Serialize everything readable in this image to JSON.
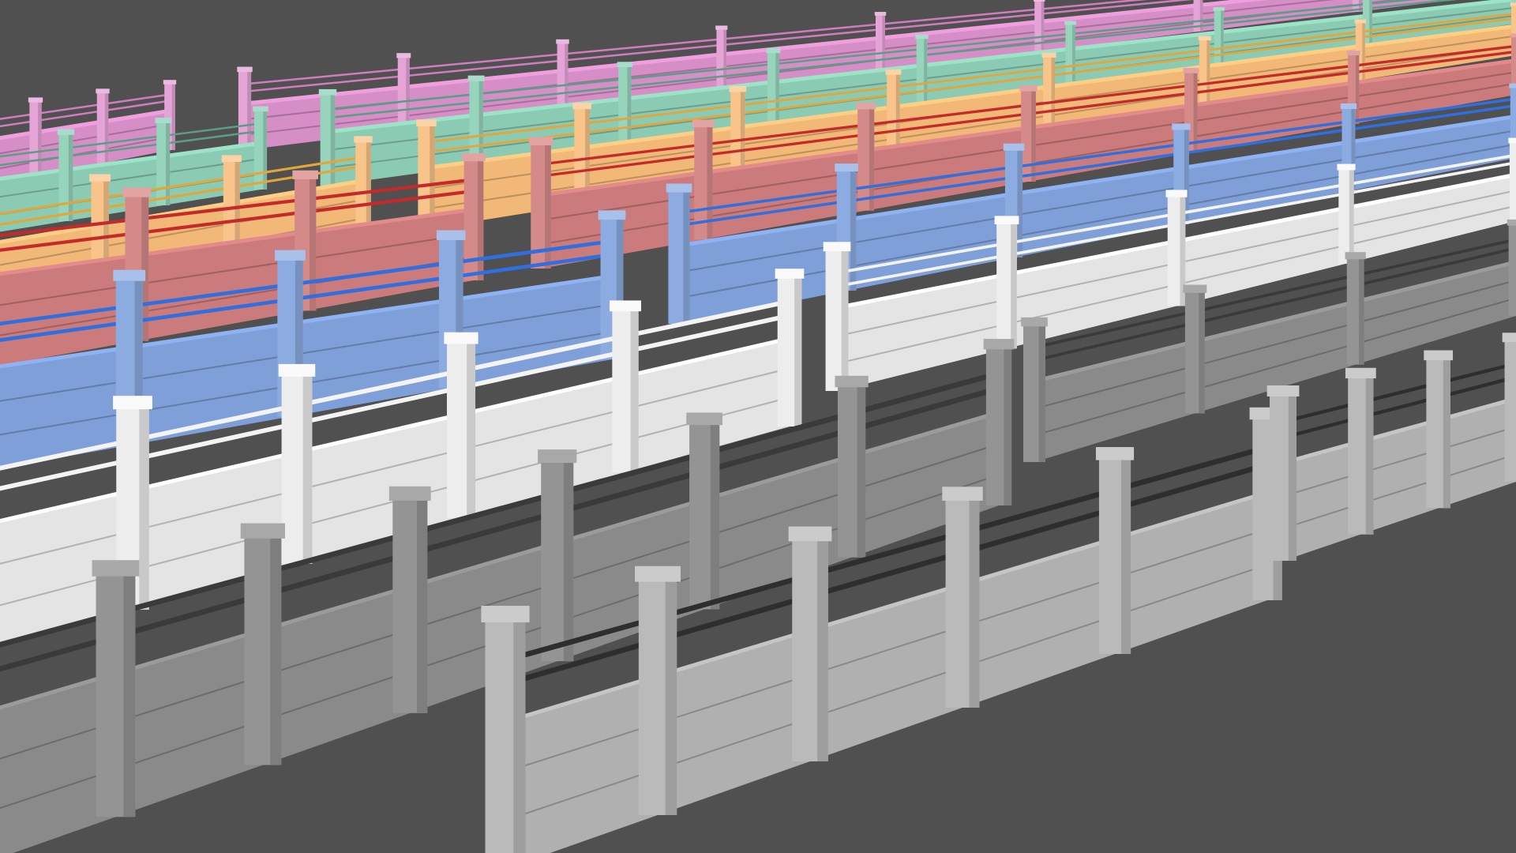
{
  "scene": {
    "background": "#505050",
    "rows": [
      {
        "name": "pink",
        "wall": "#d58ec6",
        "post": "#e4a4d6",
        "rail": "#d07dc0",
        "top": "#eabbe0"
      },
      {
        "name": "green",
        "wall": "#8ccbb3",
        "post": "#97d4bc",
        "rail": "#5a9e86",
        "top": "#aadccb"
      },
      {
        "name": "orange",
        "wall": "#f2b877",
        "post": "#f8c48a",
        "rail": "#e3a63a",
        "top": "#fbd3a6"
      },
      {
        "name": "red",
        "wall": "#cb7b7b",
        "post": "#d58a8a",
        "rail": "#c42a2a",
        "top": "#e2a3a3"
      },
      {
        "name": "blue",
        "wall": "#7f9fd8",
        "post": "#8cabe0",
        "rail": "#2f6fe0",
        "top": "#a8c0ea"
      },
      {
        "name": "white",
        "wall": "#e4e4e4",
        "post": "#ededed",
        "rail": "#f4f4f4",
        "top": "#fafafa"
      },
      {
        "name": "concrete-dark",
        "wall": "#8a8a8a",
        "post": "#949494",
        "rail": "#3a3a3a",
        "top": "#a8a8a8"
      },
      {
        "name": "concrete-front",
        "wall": "#b0b0b0",
        "post": "#bababa",
        "rail": "#2e2e2e",
        "top": "#cbcbcb"
      }
    ]
  }
}
